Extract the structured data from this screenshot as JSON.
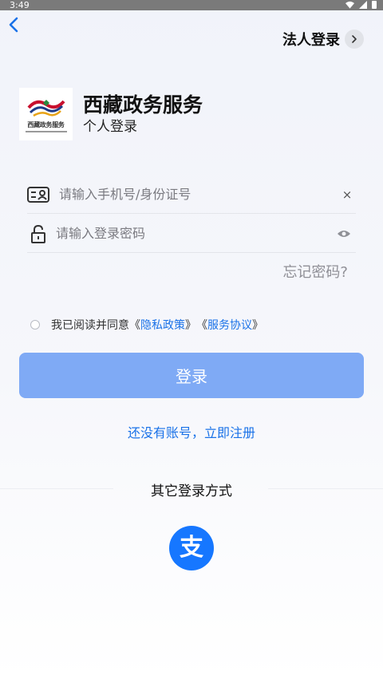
{
  "status_bar": {
    "time": "3:49"
  },
  "header": {
    "corp_login_label": "法人登录"
  },
  "brand": {
    "logo_caption": "西藏政务服务",
    "title": "西藏政务服务",
    "subtitle": "个人登录"
  },
  "form": {
    "phone_placeholder": "请输入手机号/身份证号",
    "password_placeholder": "请输入登录密码",
    "clear_glyph": "×",
    "forgot_label": "忘记密码?"
  },
  "agreement": {
    "prefix": "我已阅读并同意",
    "open_quote_1": "《",
    "privacy_label": "隐私政策",
    "close_quote_1": "》",
    "open_quote_2": "《",
    "service_label": "服务协议",
    "close_quote_2": "》"
  },
  "actions": {
    "login_label": "登录",
    "register_label": "还没有账号，立即注册"
  },
  "other_login": {
    "title": "其它登录方式",
    "alipay_glyph": "支"
  },
  "colors": {
    "accent": "#1a72e8",
    "login_button": "#7faaf5",
    "alipay": "#1677ff"
  },
  "icons": [
    "back-icon",
    "chevron-right-icon",
    "id-card-icon",
    "lock-icon",
    "clear-icon",
    "eye-icon",
    "alipay-icon",
    "wifi-icon",
    "signal-icon",
    "battery-icon"
  ]
}
